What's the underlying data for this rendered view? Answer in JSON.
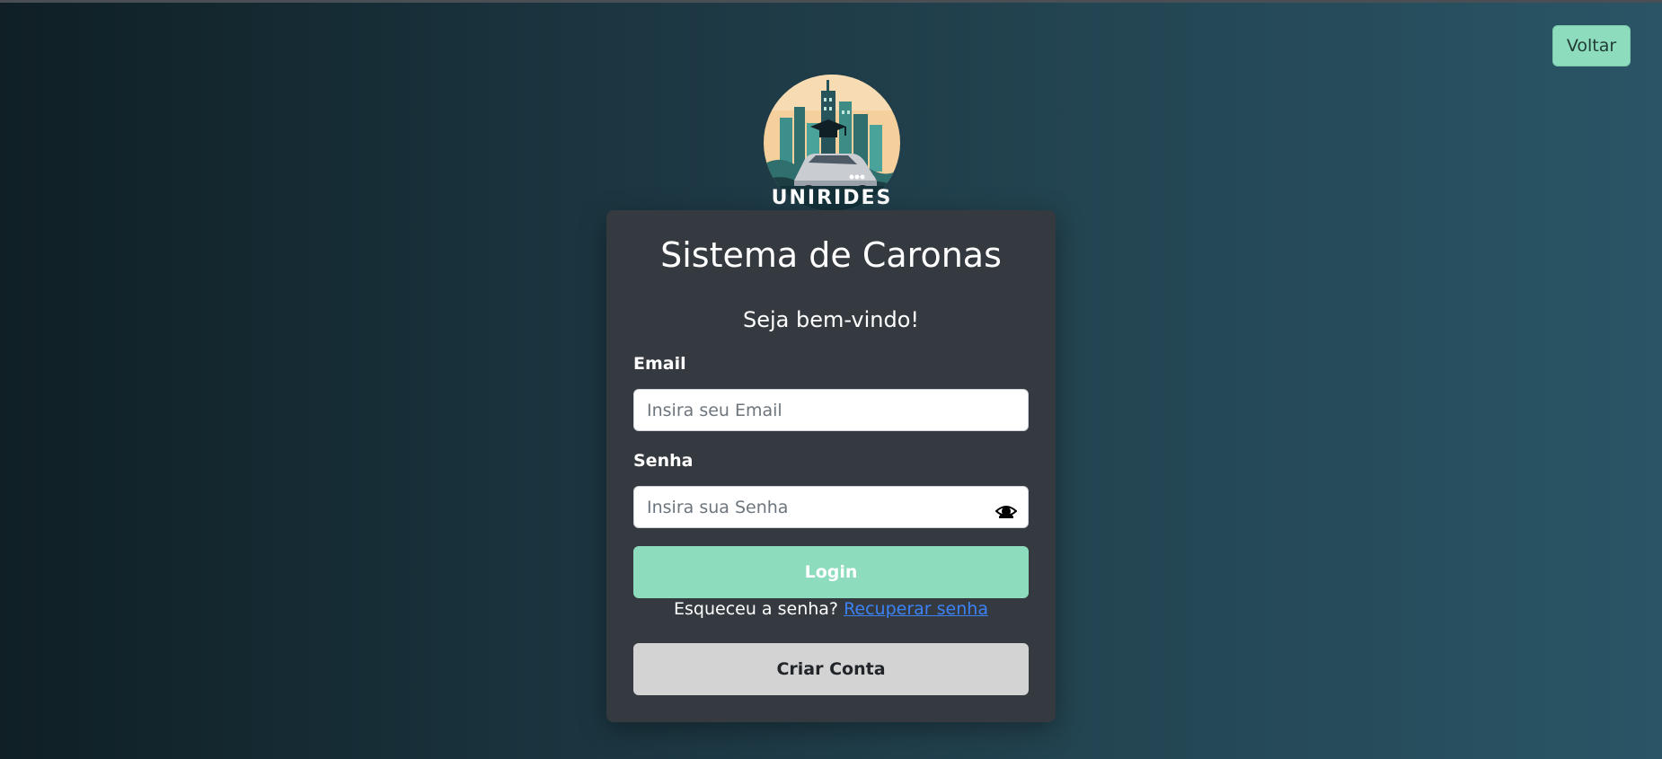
{
  "header": {
    "back_label": "Voltar"
  },
  "logo": {
    "text": "UNIRIDES",
    "icon": "car-city-graduation-logo"
  },
  "card": {
    "title": "Sistema de Caronas",
    "subtitle": "Seja bem-vindo!",
    "email": {
      "label": "Email",
      "placeholder": "Insira seu Email",
      "value": ""
    },
    "password": {
      "label": "Senha",
      "placeholder": "Insira sua Senha",
      "value": "",
      "toggle_icon": "eye-icon"
    },
    "login_label": "Login",
    "forgot_text": "Esqueceu a senha?",
    "forgot_link": "Recuperar senha",
    "create_label": "Criar Conta"
  },
  "colors": {
    "accent": "#8edcbe",
    "card_bg": "#353a40",
    "link": "#3b82f6",
    "secondary_button": "#d3d3d3"
  }
}
